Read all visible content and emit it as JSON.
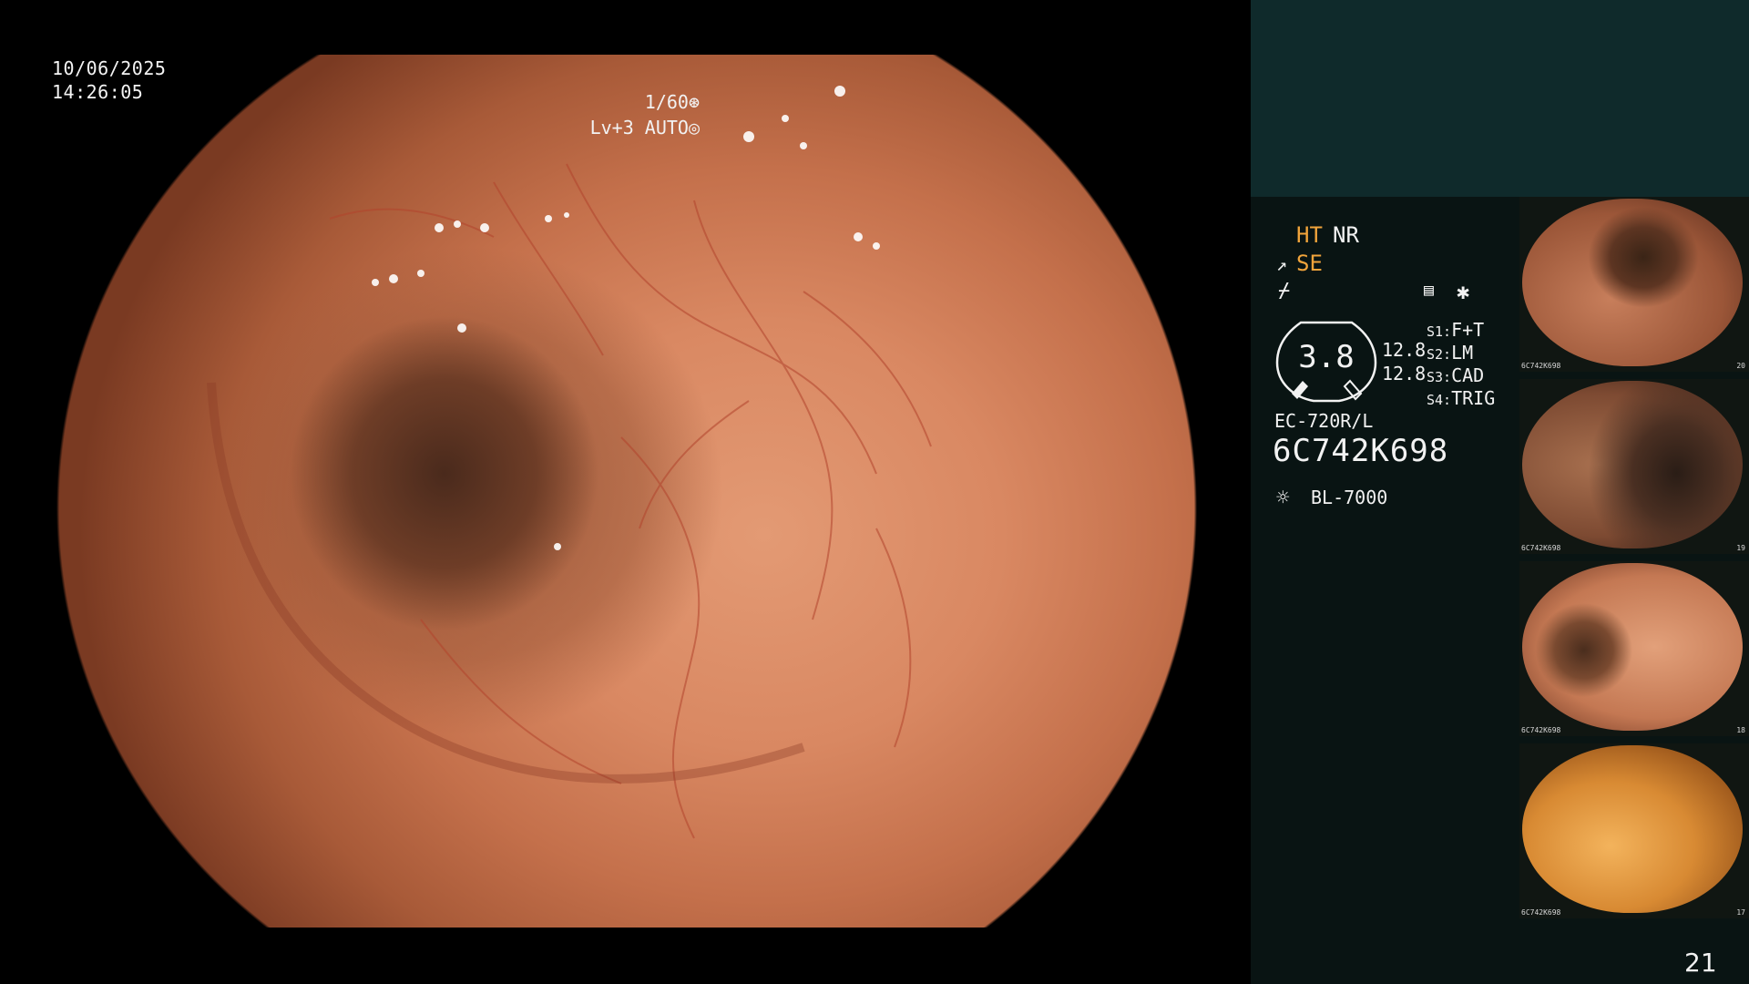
{
  "overlay": {
    "date": "10/06/2025",
    "time": "14:26:05",
    "shutter": "1/60",
    "shutter_icon": "shutter-icon",
    "level": "Lv+3 AUTO",
    "level_icon": "iris-icon"
  },
  "panel": {
    "tags": {
      "ht": "HT",
      "nr": "NR",
      "se": "SE"
    },
    "icons": {
      "probe": "↗",
      "tilde": "⌿",
      "doc": "▤",
      "star": "✱"
    },
    "gauge_value": "3.8",
    "gauge_side": [
      "12.8",
      "12.8"
    ],
    "switches": [
      {
        "key": "S1:",
        "value": "F+T"
      },
      {
        "key": "S2:",
        "value": "LM"
      },
      {
        "key": "S3:",
        "value": "CAD"
      },
      {
        "key": "S4:",
        "value": "TRIG"
      }
    ],
    "scope_model": "EC-720R/L",
    "serial": "6C742K698",
    "light_icon": "☼",
    "light_model": "BL-7000",
    "page_number": "21"
  },
  "thumbnails": [
    {
      "caption": "6C742K698",
      "number": "20"
    },
    {
      "caption": "6C742K698",
      "number": "19"
    },
    {
      "caption": "6C742K698",
      "number": "18"
    },
    {
      "caption": "6C742K698",
      "number": "17"
    }
  ],
  "colors": {
    "accent_orange": "#f1a43b",
    "panel_top": "#0f2a2b",
    "panel_main": "#091413"
  }
}
